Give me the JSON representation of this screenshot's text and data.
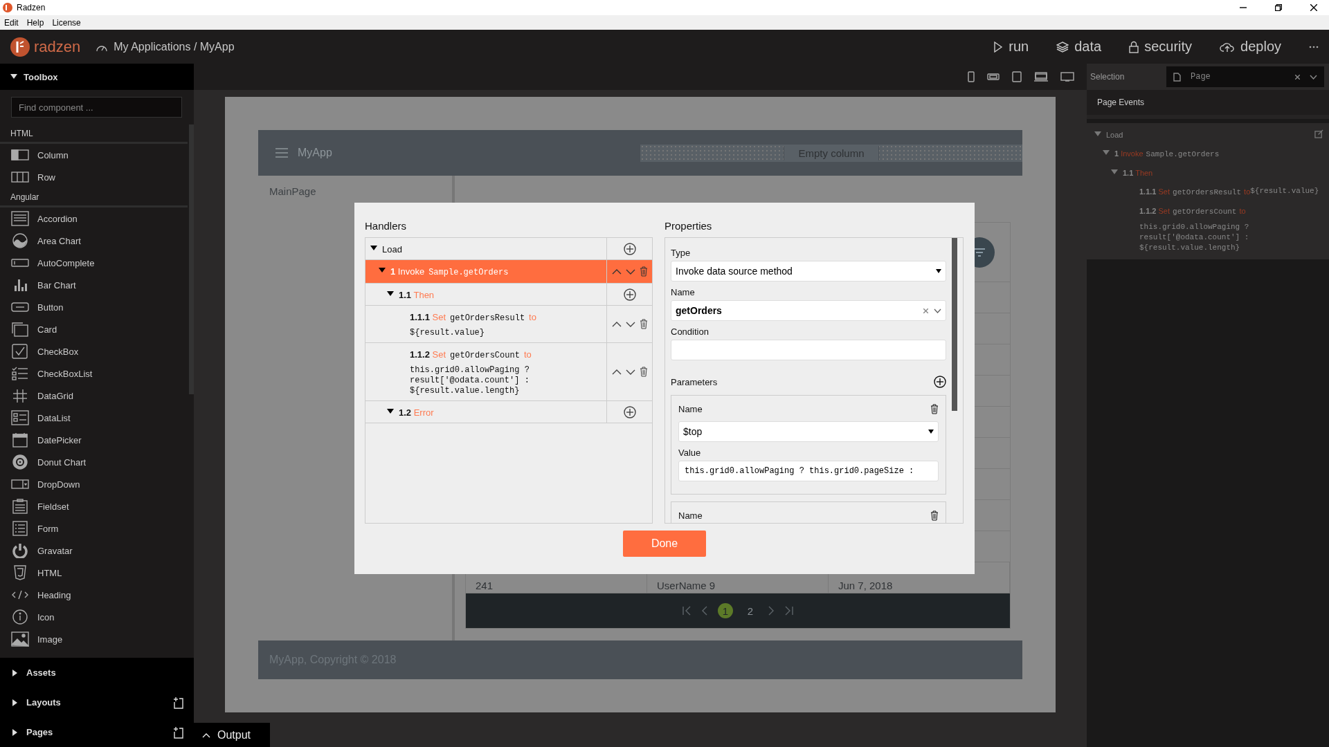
{
  "window": {
    "title": "Radzen"
  },
  "menu": [
    "Edit",
    "Help",
    "License"
  ],
  "nav": {
    "brand": "radzen",
    "breadcrumb": "My Applications / MyApp",
    "actions": [
      "run",
      "data",
      "security",
      "deploy"
    ]
  },
  "toolbox": {
    "title": "Toolbox",
    "expanded": true,
    "search_placeholder": "Find component ...",
    "sections": [
      {
        "title": "HTML",
        "items": [
          "Column",
          "Row"
        ]
      },
      {
        "title": "Angular",
        "items": [
          "Accordion",
          "Area Chart",
          "AutoComplete",
          "Bar Chart",
          "Button",
          "Card",
          "CheckBox",
          "CheckBoxList",
          "DataGrid",
          "DataList",
          "DatePicker",
          "Donut Chart",
          "DropDown",
          "Fieldset",
          "Form",
          "Gravatar",
          "HTML",
          "Heading",
          "Icon",
          "Image"
        ]
      }
    ]
  },
  "panels": [
    {
      "title": "Assets",
      "expanded": false,
      "add": false
    },
    {
      "title": "Layouts",
      "expanded": false,
      "add": true
    },
    {
      "title": "Pages",
      "expanded": false,
      "add": true
    }
  ],
  "output": {
    "label": "Output"
  },
  "preview": {
    "app_title": "MyApp",
    "empty_column": "Empty column",
    "nav_item": "MainPage",
    "grid_row": [
      "241",
      "UserName 9",
      "Jun 7, 2018"
    ],
    "pages": [
      {
        "label": "1",
        "selected": true
      },
      {
        "label": "2",
        "selected": false
      }
    ],
    "footer": "MyApp, Copyright © 2018"
  },
  "dialog": {
    "handlers_title": "Handlers",
    "properties_title": "Properties",
    "tree": [
      {
        "kind": "event",
        "label": "Load",
        "expanded": true,
        "selected": false,
        "children": [
          {
            "kind": "action",
            "number": "1",
            "action": "Invoke",
            "target": "Sample.getOrders",
            "expanded": true,
            "selected": true,
            "children": [
              {
                "kind": "branch",
                "number": "1.1",
                "action": "Then",
                "expanded": true,
                "selected": false,
                "children": [
                  {
                    "kind": "action",
                    "number": "1.1.1",
                    "action": "Set",
                    "target": "getOrdersResult",
                    "connector": "to",
                    "value": "${result.value}",
                    "selected": false
                  },
                  {
                    "kind": "action",
                    "number": "1.1.2",
                    "action": "Set",
                    "target": "getOrdersCount",
                    "connector": "to",
                    "value": "this.grid0.allowPaging ? result['@odata.count'] : ${result.value.length}",
                    "selected": false
                  }
                ]
              },
              {
                "kind": "branch",
                "number": "1.2",
                "action": "Error",
                "expanded": true,
                "selected": false
              }
            ]
          }
        ]
      }
    ],
    "type": {
      "label": "Type",
      "value": "Invoke data source method"
    },
    "name": {
      "label": "Name",
      "value": "getOrders"
    },
    "condition": {
      "label": "Condition"
    },
    "parameters": {
      "label": "Parameters",
      "items": [
        {
          "name_label": "Name",
          "name": "$top",
          "value_label": "Value",
          "value": "this.grid0.allowPaging ? this.grid0.pageSize :"
        },
        {
          "name_label": "Name"
        }
      ]
    },
    "done": "Done"
  },
  "selection": {
    "label": "Selection",
    "value": "Page"
  },
  "events": {
    "title": "Page Events",
    "tree": [
      {
        "kind": "event",
        "label": "Load",
        "expanded": true,
        "children": [
          {
            "kind": "action",
            "number": "1",
            "action": "Invoke",
            "target": "Sample.getOrders",
            "expanded": true,
            "children": [
              {
                "kind": "branch",
                "number": "1.1",
                "action": "Then",
                "expanded": true,
                "children": [
                  {
                    "kind": "action",
                    "number": "1.1.1",
                    "action": "Set",
                    "target": "getOrdersResult",
                    "connector": "to",
                    "value": "${result.value}"
                  },
                  {
                    "kind": "action",
                    "number": "1.1.2",
                    "action": "Set",
                    "target": "getOrdersCount",
                    "connector": "to",
                    "value": "this.grid0.allowPaging ? result['@odata.count'] : ${result.value.length}"
                  }
                ]
              }
            ]
          }
        ]
      }
    ]
  }
}
